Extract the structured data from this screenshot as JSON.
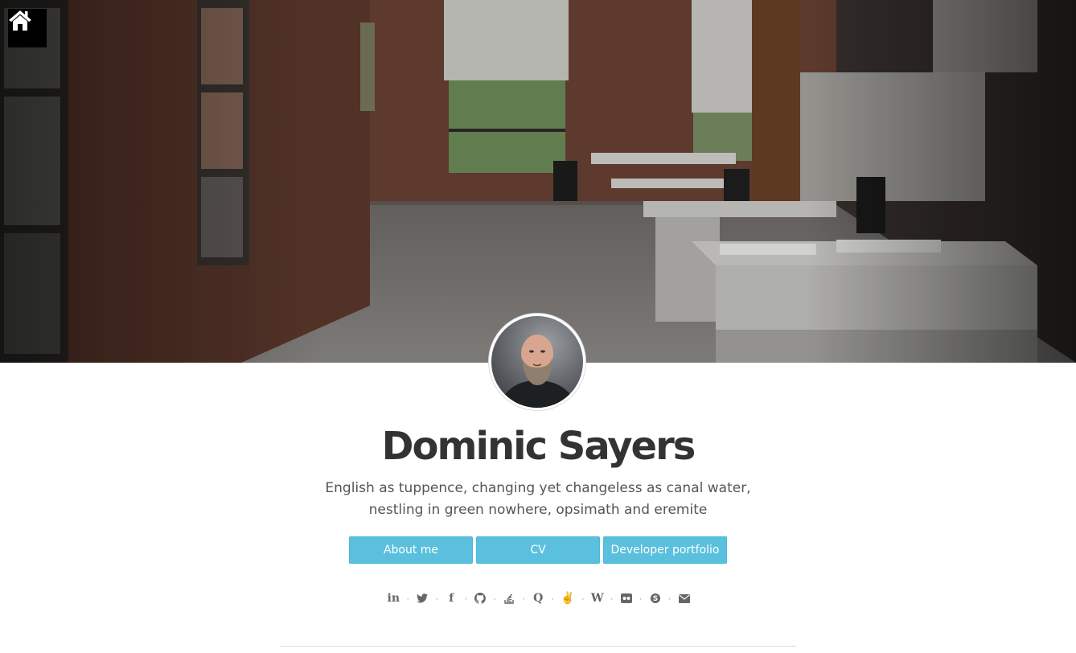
{
  "profile": {
    "name": "Dominic Sayers",
    "tagline_line1": "English as tuppence, changing yet changeless as canal water,",
    "tagline_line2": "nestling in green nowhere, opsimath and eremite"
  },
  "nav": {
    "home_icon": "home-icon"
  },
  "buttons": [
    {
      "label": "About me"
    },
    {
      "label": "CV"
    },
    {
      "label": "Developer portfolio"
    }
  ],
  "social": [
    {
      "icon": "linkedin-icon",
      "glyph": "in"
    },
    {
      "icon": "twitter-icon",
      "glyph": "🐦"
    },
    {
      "icon": "facebook-icon",
      "glyph": "f"
    },
    {
      "icon": "github-icon",
      "glyph": "◉"
    },
    {
      "icon": "stackoverflow-icon",
      "glyph": "≡"
    },
    {
      "icon": "quora-icon",
      "glyph": "Q"
    },
    {
      "icon": "angellist-icon",
      "glyph": "✌"
    },
    {
      "icon": "wikipedia-icon",
      "glyph": "W"
    },
    {
      "icon": "flickr-icon",
      "glyph": "●●"
    },
    {
      "icon": "skype-icon",
      "glyph": "S"
    },
    {
      "icon": "email-icon",
      "glyph": "✉"
    }
  ],
  "colors": {
    "button_bg": "#5bc0de",
    "button_border": "#46b8da",
    "name_text": "#333333",
    "tagline_text": "#555555"
  }
}
